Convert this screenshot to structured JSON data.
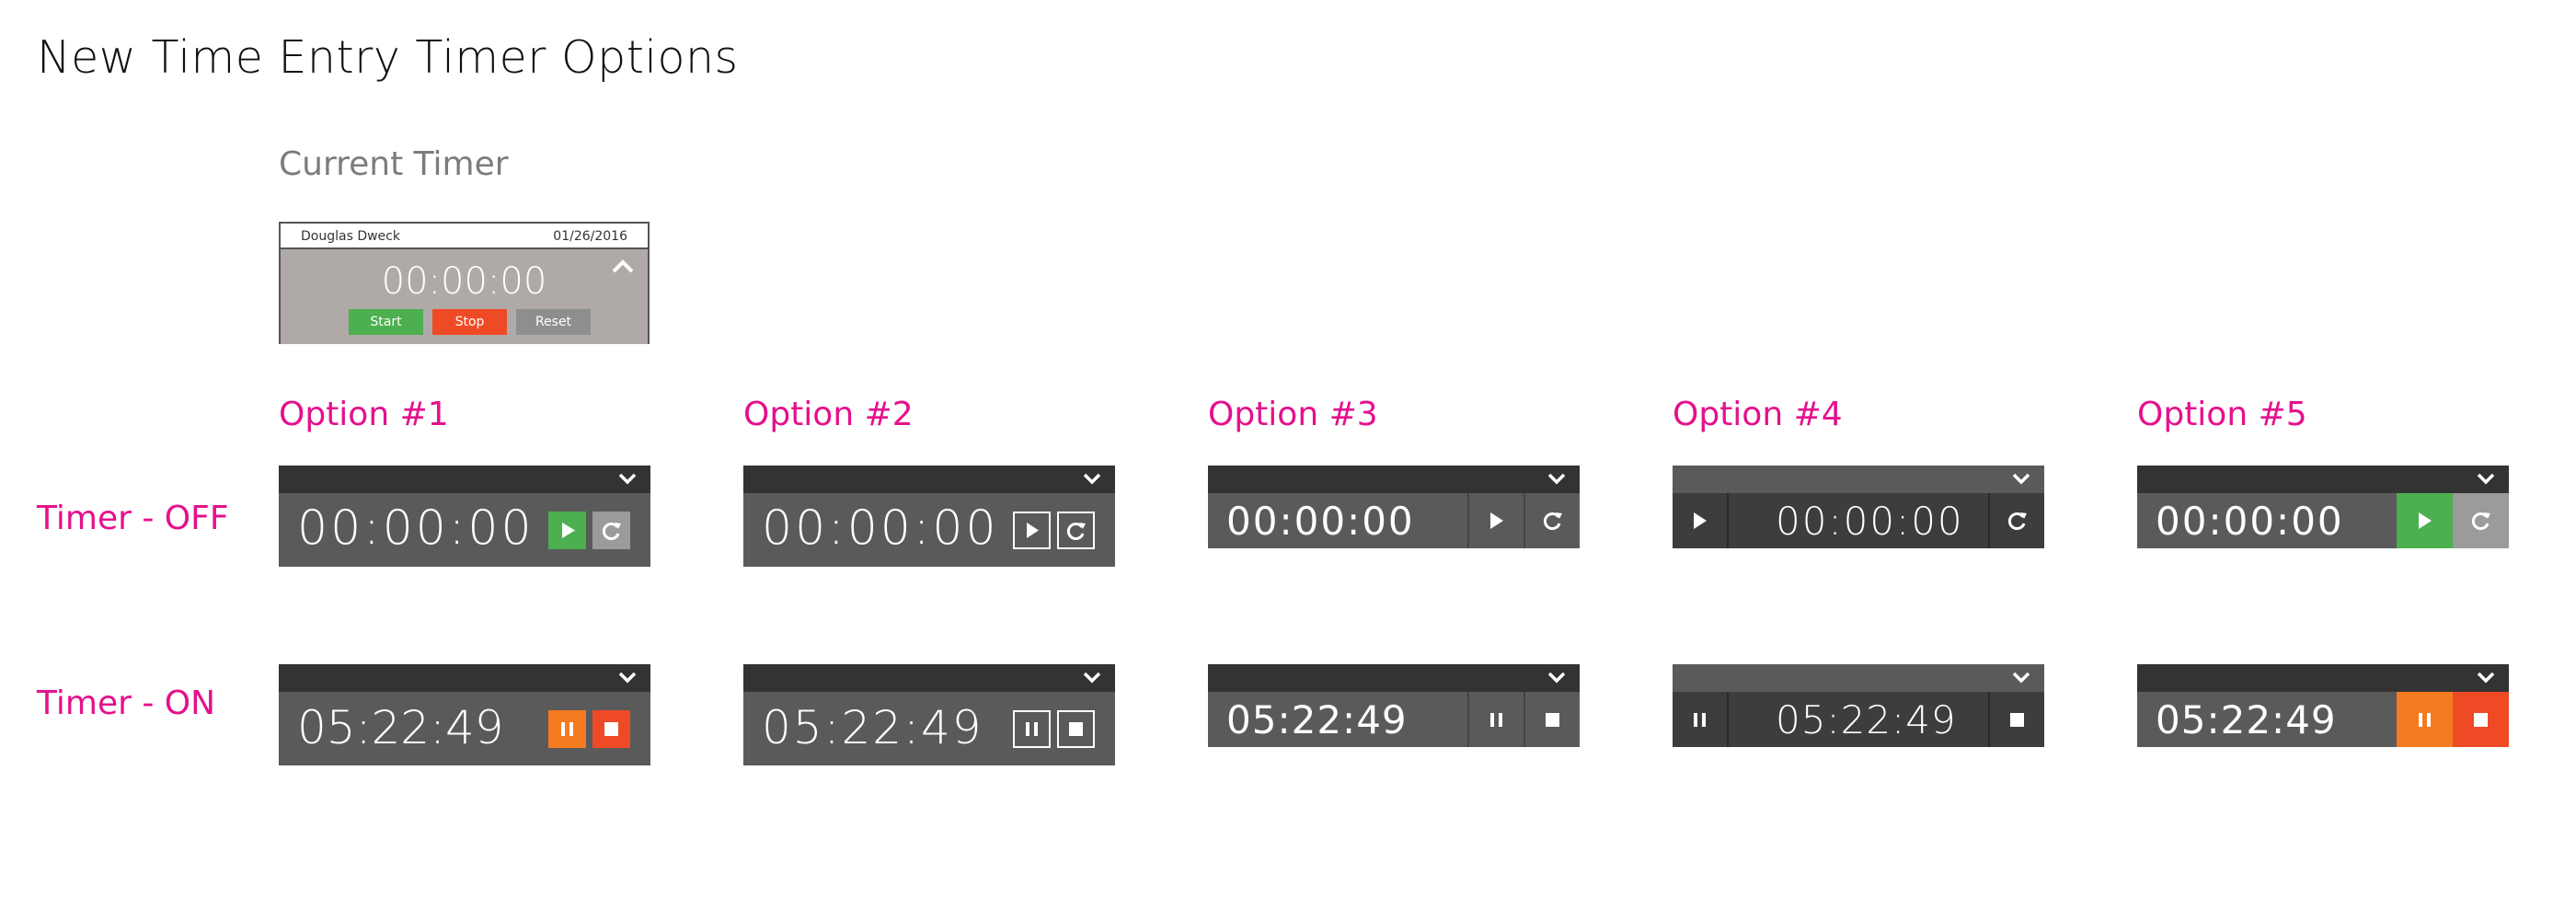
{
  "page_title": "New Time Entry Timer Options",
  "current": {
    "label": "Current Timer",
    "user": "Douglas Dweck",
    "date": "01/26/2016",
    "time": "00:00:00",
    "start_label": "Start",
    "stop_label": "Stop",
    "reset_label": "Reset"
  },
  "options": [
    "Option #1",
    "Option #2",
    "Option #3",
    "Option #4",
    "Option #5"
  ],
  "rows": {
    "off_label": "Timer - OFF",
    "on_label": "Timer - ON",
    "off_time": "00:00:00",
    "on_time": "05:22:49"
  },
  "icons": [
    "chevron-down-icon",
    "play-icon",
    "reset-icon",
    "pause-icon",
    "stop-icon",
    "caret-up-icon"
  ],
  "colors": {
    "accent": "#e5108c",
    "green": "#4caf50",
    "gray": "#9b9b9b",
    "orange": "#f47b20",
    "red": "#ef4a26",
    "header": "#333333",
    "body": "#5a5a5a"
  }
}
